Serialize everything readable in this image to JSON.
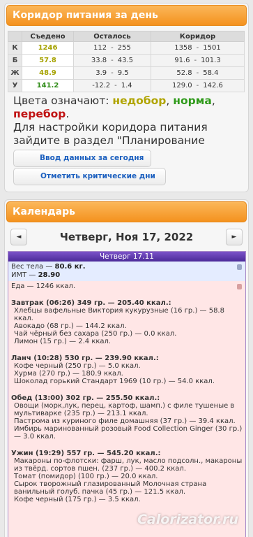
{
  "corridor": {
    "title": "Коридор питания за день",
    "headers": [
      "",
      "Съедено",
      "Осталось",
      "Коридор"
    ],
    "rows": [
      {
        "label": "К",
        "eaten": "1246",
        "eaten_status": "under",
        "left_min": "112",
        "left_max": "255",
        "corr_min": "1358",
        "corr_max": "1501"
      },
      {
        "label": "Б",
        "eaten": "57.8",
        "eaten_status": "under",
        "left_min": "33.8",
        "left_max": "43.5",
        "corr_min": "91.6",
        "corr_max": "101.3"
      },
      {
        "label": "Ж",
        "eaten": "48.9",
        "eaten_status": "under",
        "left_min": "3.9",
        "left_max": "9.5",
        "corr_min": "52.8",
        "corr_max": "58.4"
      },
      {
        "label": "У",
        "eaten": "141.2",
        "eaten_status": "norm",
        "left_min": "-12.2",
        "left_max": "1.4",
        "corr_min": "129.0",
        "corr_max": "142.6"
      }
    ],
    "separator": "-",
    "legend": {
      "prefix": "Цвета означают: ",
      "under": "недобор",
      "comma1": ", ",
      "norm": "норма",
      "comma2": ",",
      "over": "перебор",
      "dot": ".",
      "hint": "Для настройки коридора питания зайдите в раздел \"Планирование питания\"."
    },
    "buttons": {
      "enter_data": "Ввод данных за сегодня",
      "mark_days": "Отметить критические дни"
    }
  },
  "calendar": {
    "title": "Календарь",
    "prev_label": "◄",
    "next_label": "►",
    "date_label": "Четверг, Ноя 17, 2022",
    "day_header": "Четверг 17.11",
    "weight_label": "Вес тела — ",
    "weight_value": "80.6 кг.",
    "bmi_label": "ИМТ — ",
    "bmi_value": "28.90",
    "food_total": "Еда — 1246 ккал.",
    "meals": [
      {
        "title": "Завтрак (06:26) 349 гр. — 205.40 ккал.:",
        "items": [
          "Хлебцы вафельные Виктория кукурузные (16 гр.) — 58.8 ккал.",
          "Авокадо (68 гр.) — 144.2 ккал.",
          "Чай чёрный без сахара (250 гр.) — 0.0 ккал.",
          "Лимон (15 гр.) — 2.4 ккал."
        ]
      },
      {
        "title": "Ланч (10:28) 530 гр. — 239.90 ккал.:",
        "items": [
          "Кофе черный (250 гр.) — 5.0 ккал.",
          "Хурма (270 гр.) — 180.9 ккал.",
          "Шоколад горький Стандарт 1969 (10 гр.) — 54.0 ккал."
        ]
      },
      {
        "title": "Обед (13:00) 302 гр. — 255.50 ккал.:",
        "items": [
          "Овощи (морк,лук, перец, картоф, шамп.) с филе тушеные в мультиварке (235 гр.) — 213.1 ккал.",
          "Пастрома из куриного филе домашняя (37 гр.) — 39.4 ккал.",
          "Имбирь маринованный розовый Food Collection Ginger (30 гр.) — 3.0 ккал."
        ]
      },
      {
        "title": "Ужин (19:29) 557 гр. — 545.20 ккал.:",
        "items": [
          "Макароны по-флотски: фарш, лук, масло подсолн., макароны из твёрд. сортов пшен. (237 гр.) — 400.2 ккал.",
          "Томат (помидор) (100 гр.) — 20.0 ккал.",
          "Сырок творожный глазированный Молочная страна ванильный голуб. пачка (45 гр.) — 121.5 ккал.",
          "Кофе черный (175 гр.) — 3.5 ккал."
        ]
      }
    ]
  },
  "watermark": "Calorizator.ru",
  "colors": {
    "accent": "#f4921e",
    "under": "#a6a200",
    "norm": "#2e8b16",
    "over": "#c01212",
    "day_header": "#5b36ad"
  }
}
